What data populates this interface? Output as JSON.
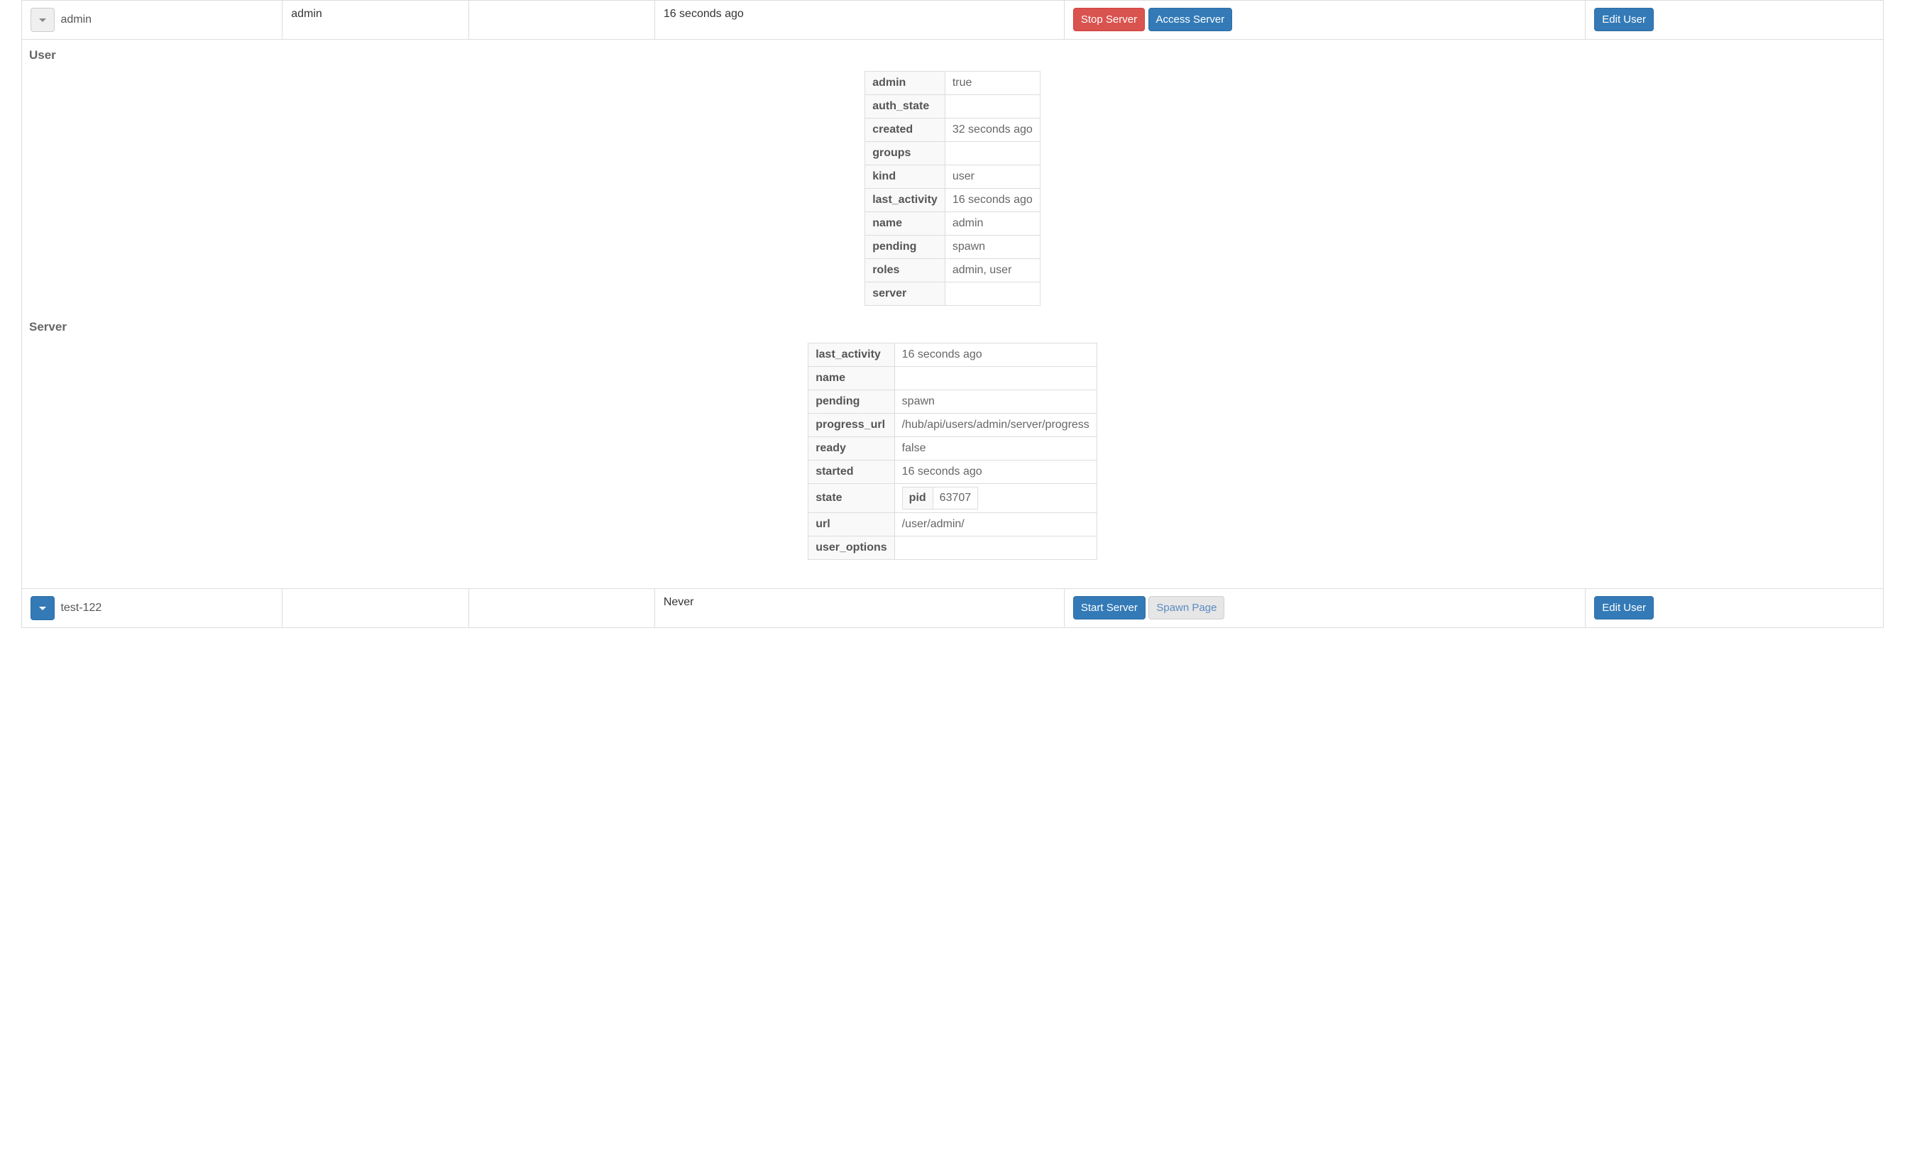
{
  "rows": {
    "admin": {
      "user_col": "admin",
      "admin_col": "admin",
      "last_activity_col": "16 seconds ago",
      "actions": {
        "stop_server": "Stop Server",
        "access_server": "Access Server"
      },
      "edit_label": "Edit User"
    },
    "test122": {
      "user_col": "test-122",
      "admin_col": "",
      "last_activity_col": "Never",
      "actions": {
        "start_server": "Start Server",
        "spawn_page": "Spawn Page"
      },
      "edit_label": "Edit User"
    }
  },
  "details": {
    "user_section_title": "User",
    "server_section_title": "Server",
    "user_table": {
      "admin_k": "admin",
      "admin_v": "true",
      "auth_state_k": "auth_state",
      "auth_state_v": "",
      "created_k": "created",
      "created_v": "32 seconds ago",
      "groups_k": "groups",
      "groups_v": "",
      "kind_k": "kind",
      "kind_v": "user",
      "last_activity_k": "last_activity",
      "last_activity_v": "16 seconds ago",
      "name_k": "name",
      "name_v": "admin",
      "pending_k": "pending",
      "pending_v": "spawn",
      "roles_k": "roles",
      "roles_v": "admin, user",
      "server_k": "server",
      "server_v": ""
    },
    "server_table": {
      "last_activity_k": "last_activity",
      "last_activity_v": "16 seconds ago",
      "name_k": "name",
      "name_v": "",
      "pending_k": "pending",
      "pending_v": "spawn",
      "progress_url_k": "progress_url",
      "progress_url_v": "/hub/api/users/admin/server/progress",
      "ready_k": "ready",
      "ready_v": "false",
      "started_k": "started",
      "started_v": "16 seconds ago",
      "state_k": "state",
      "state_pid_k": "pid",
      "state_pid_v": "63707",
      "url_k": "url",
      "url_v": "/user/admin/",
      "user_options_k": "user_options",
      "user_options_v": ""
    }
  }
}
